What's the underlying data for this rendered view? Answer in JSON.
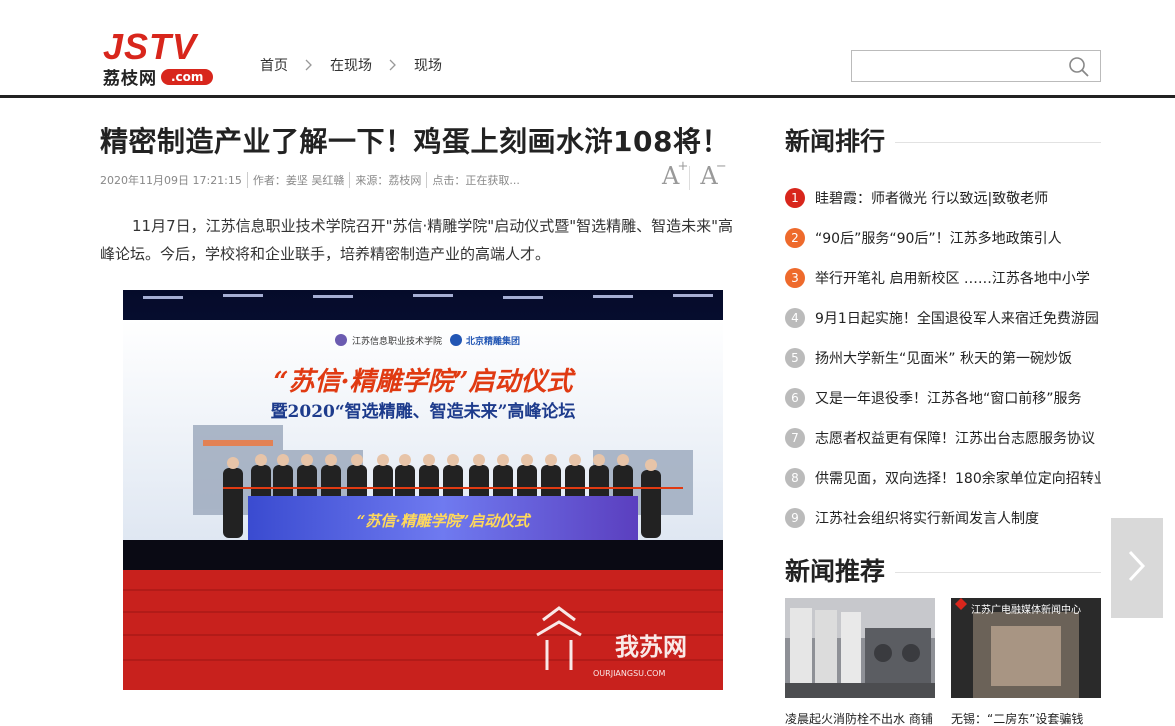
{
  "header": {
    "logo_main": "JSTV",
    "logo_cn": "荔枝网",
    "logo_com": ".com",
    "breadcrumb": [
      "首页",
      "在现场",
      "现场"
    ],
    "search_placeholder": ""
  },
  "article": {
    "title": "精密制造产业了解一下！鸡蛋上刻画水浒108将！",
    "meta": {
      "datetime": "2020年11月09日  17:21:15",
      "author": "作者：姜坚  吴红赣",
      "source": "来源：荔枝网",
      "clicks": "点击：正在获取..."
    },
    "font_up": "A",
    "font_up_sup": "+",
    "font_down": "A",
    "font_down_sup": "−",
    "lead": "11月7日，江苏信息职业技术学院召开\"苏信·精雕学院\"启动仪式暨\"智选精雕、智造未来\"高峰论坛。今后，学校将和企业联手，培养精密制造产业的高端人才。",
    "photo": {
      "screen_logo_left": "江苏信息职业技术学院",
      "screen_logo_right": "北京精雕集团",
      "screen_title": "“苏信·精雕学院”启动仪式",
      "screen_subtitle": "暨2020“智选精雕、智造未来”高峰论坛",
      "podium_text": "“苏信·精雕学院”启动仪式",
      "watermark": "我苏网",
      "watermark_url": "OURJIANGSU.COM"
    }
  },
  "sidebar": {
    "ranking_title": "新闻排行",
    "ranking": [
      {
        "num": "1",
        "text": "眭碧霞：师者微光  行以致远|致敬老师",
        "color": "#d8261c"
      },
      {
        "num": "2",
        "text": "“90后”服务“90后”！江苏多地政策引人",
        "color": "#ee6a2c"
      },
      {
        "num": "3",
        "text": "举行开笔礼  启用新校区  ……江苏各地中小学",
        "color": "#ee6a2c"
      },
      {
        "num": "4",
        "text": "9月1日起实施！全国退役军人来宿迁免费游园",
        "color": "#bbbbbb"
      },
      {
        "num": "5",
        "text": "扬州大学新生“见面米”  秋天的第一碗炒饭",
        "color": "#bbbbbb"
      },
      {
        "num": "6",
        "text": "又是一年退役季！江苏各地“窗口前移”服务",
        "color": "#bbbbbb"
      },
      {
        "num": "7",
        "text": "志愿者权益更有保障！江苏出台志愿服务协议",
        "color": "#bbbbbb"
      },
      {
        "num": "8",
        "text": "供需见面，双向选择！180余家单位定向招转业",
        "color": "#bbbbbb"
      },
      {
        "num": "9",
        "text": "江苏社会组织将实行新闻发言人制度",
        "color": "#bbbbbb"
      }
    ],
    "recommend_title": "新闻推荐",
    "recommend": [
      {
        "caption": "凌晨起火消防栓不出水  商铺"
      },
      {
        "caption": "无锡：“二房东”设套骗钱",
        "overlay": "江苏广电融媒体新闻中心"
      }
    ]
  },
  "colors": {
    "brand_red": "#d8261c",
    "rank_orange": "#ee6a2c",
    "rank_gray": "#bbbbbb"
  }
}
